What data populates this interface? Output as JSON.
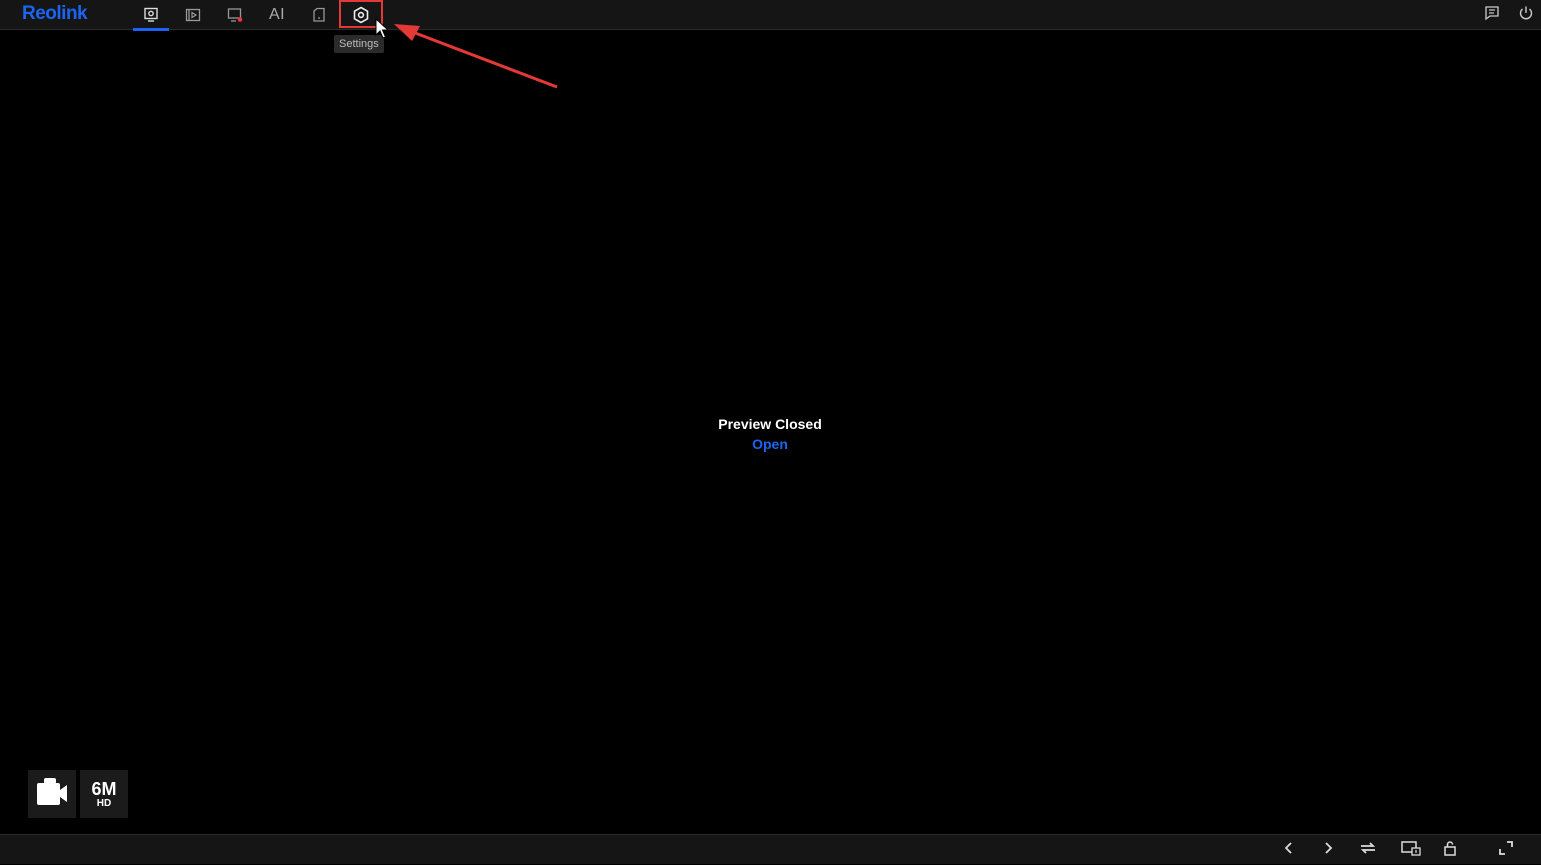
{
  "app": {
    "logo_text": "Reolink",
    "accent_color": "#1c64f2"
  },
  "toolbar": {
    "items": [
      {
        "name": "live-view",
        "icon": "camera-monitor-icon",
        "active": true
      },
      {
        "name": "playback",
        "icon": "playback-icon",
        "active": false
      },
      {
        "name": "alarm",
        "icon": "alarm-screen-icon",
        "active": false
      },
      {
        "name": "ai",
        "label": "AI",
        "active": false
      },
      {
        "name": "device",
        "icon": "device-icon",
        "active": false
      },
      {
        "name": "settings",
        "icon": "gear-icon",
        "active": false,
        "tooltip": "Settings"
      }
    ],
    "right": [
      {
        "name": "messages",
        "icon": "message-icon"
      },
      {
        "name": "power",
        "icon": "power-icon"
      }
    ]
  },
  "preview": {
    "status": "Preview Closed",
    "action": "Open"
  },
  "badges": {
    "camera_icon": "video-camera-icon",
    "resolution_main": "6M",
    "resolution_sub": "HD"
  },
  "bottom_toolbar": [
    {
      "name": "previous",
      "icon": "chevron-left-icon"
    },
    {
      "name": "next",
      "icon": "chevron-right-icon"
    },
    {
      "name": "switch-stream",
      "icon": "swap-icon"
    },
    {
      "name": "layout",
      "icon": "screen-layout-icon"
    },
    {
      "name": "lock",
      "icon": "unlock-icon"
    },
    {
      "name": "fullscreen",
      "icon": "fullscreen-icon"
    }
  ],
  "annotation": {
    "highlight_color": "#e53935"
  }
}
